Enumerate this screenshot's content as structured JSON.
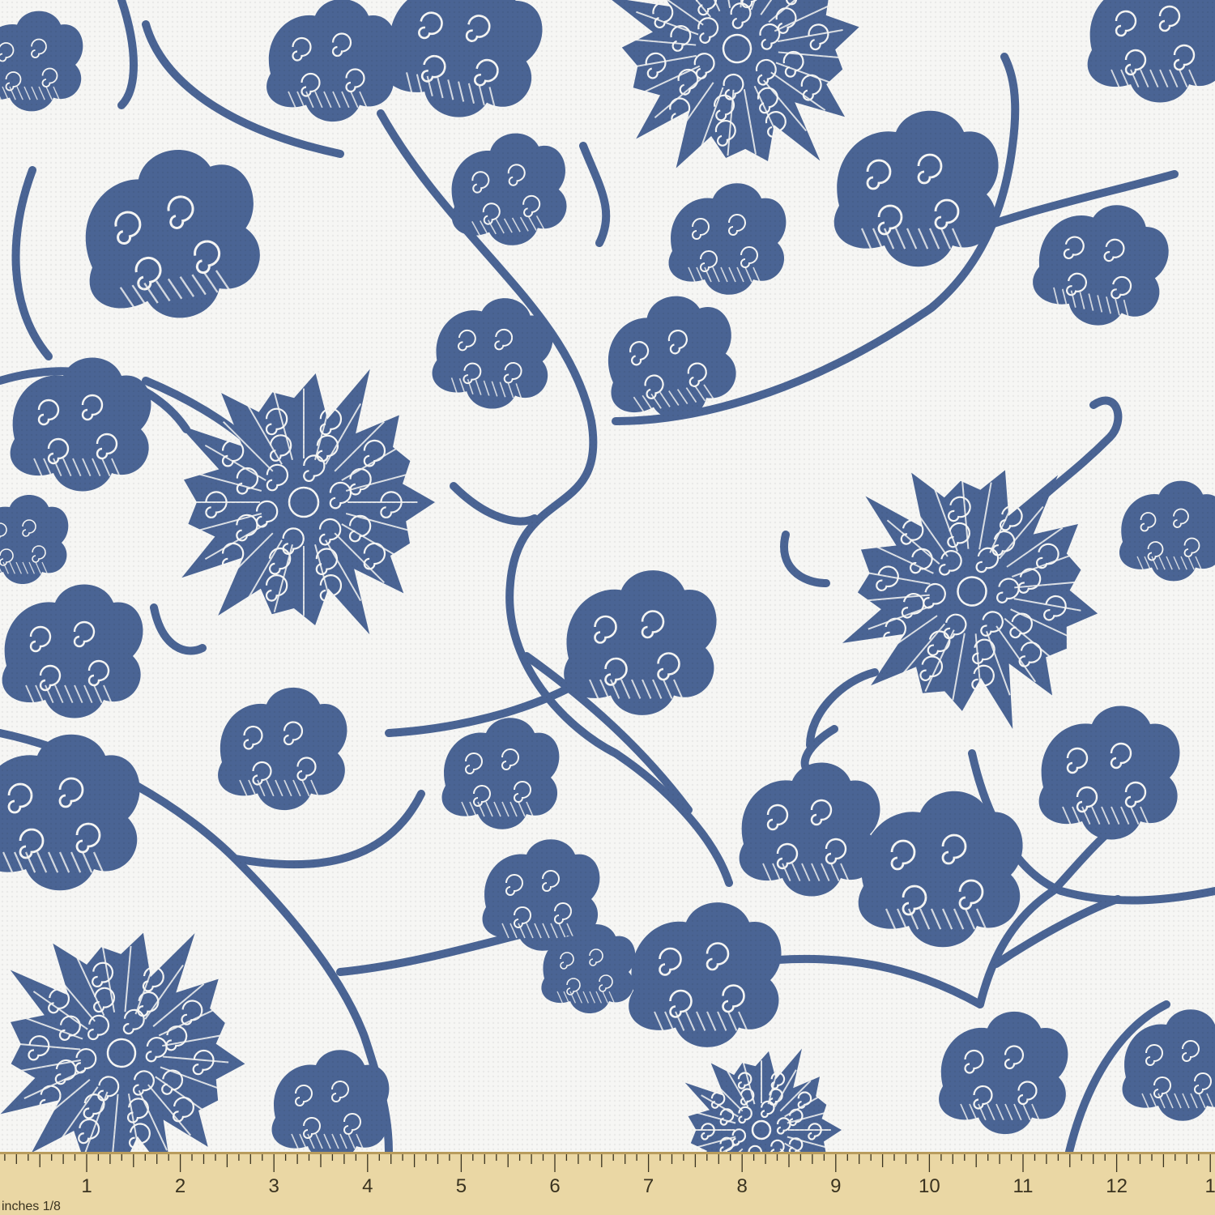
{
  "fabric": {
    "background_color": "#f6f6f4",
    "motif_color": "#4a6494",
    "highlight_color": "#f6f6f4",
    "motif": "navy blue floral vine pattern"
  },
  "ruler": {
    "background_color": "#ead7a4",
    "edge_color": "#b89c5c",
    "mark_color": "#3a3320",
    "unit_label": "inches 1/8",
    "numbers": [
      "1",
      "2",
      "3",
      "4",
      "5",
      "6",
      "7",
      "8",
      "9",
      "10",
      "11",
      "12",
      "1"
    ]
  }
}
